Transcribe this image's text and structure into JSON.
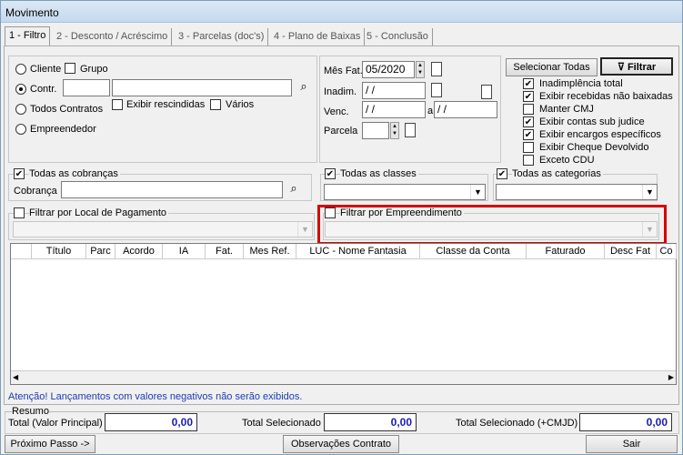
{
  "window": {
    "title": "Movimento"
  },
  "tabs": [
    "1 - Filtro",
    "2 - Desconto / Acréscimo",
    "3 - Parcelas (doc's)",
    "4 - Plano de Baixas",
    "5 - Conclusão"
  ],
  "filter": {
    "cliente": "Cliente",
    "grupo": "Grupo",
    "contr": "Contr.",
    "todos_contratos": "Todos Contratos",
    "exibir_rescindidas": "Exibir rescindidas",
    "varios": "Vários",
    "empreendedor": "Empreendedor",
    "mes_fat_label": "Mês Fat.",
    "mes_fat_value": "05/2020",
    "inadim_label": "Inadim.",
    "inadim_value": " / /",
    "venc_label": "Venc.",
    "venc_from": " / /",
    "venc_a": "a",
    "venc_to": " / /",
    "parcela_label": "Parcela",
    "selecionar_todas": "Selecionar Todas",
    "filtrar": "Filtrar"
  },
  "options": [
    {
      "label": "Inadimplência total",
      "checked": true
    },
    {
      "label": "Exibir recebidas não baixadas",
      "checked": true
    },
    {
      "label": "Manter CMJ",
      "checked": false
    },
    {
      "label": "Exibir contas sub judice",
      "checked": true
    },
    {
      "label": "Exibir encargos específicos",
      "checked": true
    },
    {
      "label": "Exibir Cheque Devolvido",
      "checked": false
    },
    {
      "label": "Exceto CDU",
      "checked": false
    }
  ],
  "groups": {
    "todas_cobrancas": "Todas as cobranças",
    "cobranca": "Cobrança",
    "todas_classes": "Todas as classes",
    "todas_categorias": "Todas as categorias",
    "local_pagamento": "Filtrar por Local de Pagamento",
    "empreendimento": "Filtrar por Empreendimento"
  },
  "grid_columns": [
    "Título",
    "Parc",
    "Acordo",
    "IA",
    "Fat.",
    "Mes Ref.",
    "LUC - Nome Fantasia",
    "Classe da Conta",
    "Faturado",
    "Desc Fat",
    "Co"
  ],
  "note": "Atenção! Lançamentos com valores negativos não serão exibidos.",
  "resumo": {
    "title": "Resumo",
    "total_principal_label": "Total (Valor Principal)",
    "total_principal": "0,00",
    "total_selecionado_label": "Total Selecionado",
    "total_selecionado": "0,00",
    "total_cmjd_label": "Total Selecionado (+CMJD)",
    "total_cmjd": "0,00"
  },
  "footer": {
    "proximo": "Próximo Passo ->",
    "observacoes": "Observações Contrato",
    "sair": "Sair"
  }
}
